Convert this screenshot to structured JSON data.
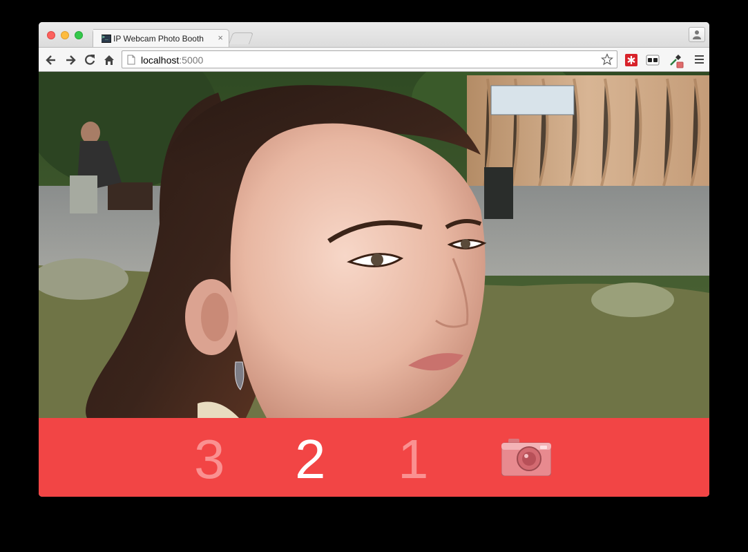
{
  "browser": {
    "tab_title": "IP Webcam Photo Booth",
    "tab_close": "×",
    "url_host": "localhost",
    "url_port": ":5000"
  },
  "countdown": {
    "steps": [
      "3",
      "2",
      "1"
    ],
    "active_step": "2",
    "shutter_icon": "camera-icon"
  },
  "colors": {
    "countdown_bar": "#f24545",
    "count_dim": "#fa9191",
    "count_active": "#ffffff"
  }
}
